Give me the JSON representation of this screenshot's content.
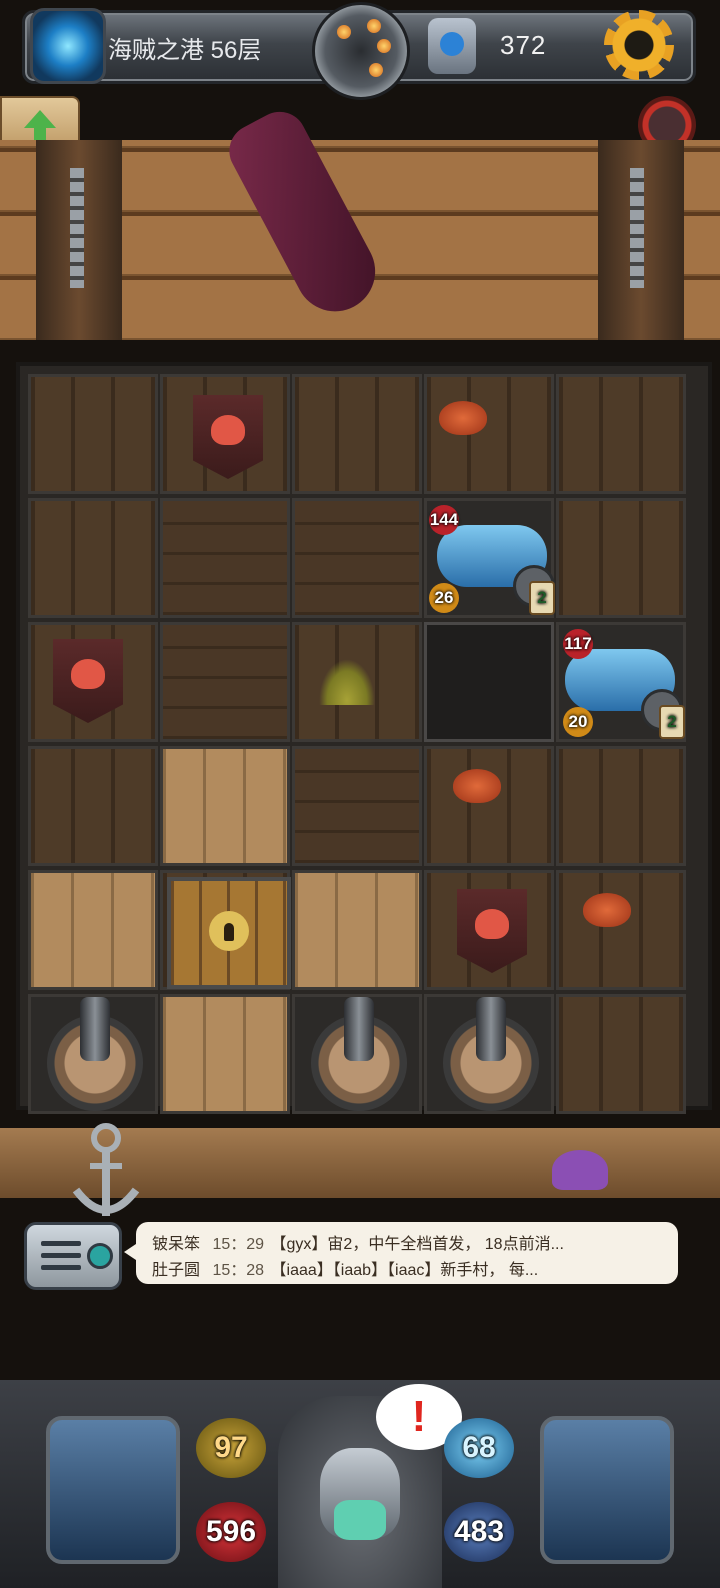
{
  "header": {
    "floor_title": "海贼之港 56层",
    "currency_value": "372",
    "settings_icon": "gear-icon",
    "portal_icon": "portal-icon",
    "bomb_medallion_icon": "bomb-medallion-icon",
    "gem_icon": "gem-icon"
  },
  "side": {
    "up_button_icon": "up-arrow-icon",
    "avatar_icon": "boss-avatar-icon"
  },
  "board": {
    "enemies": [
      {
        "name": "pirate-cannon",
        "attack": "144",
        "defense": "26",
        "level": "2"
      },
      {
        "name": "pirate-cannon",
        "attack": "117",
        "defense": "20",
        "level": "2"
      }
    ]
  },
  "chat": {
    "messages": [
      {
        "name": "铍呆笨",
        "time": "15：29",
        "text": "【gyx】宙2，中午全档首发， 18点前消..."
      },
      {
        "name": "肚子圆",
        "time": "15：28",
        "text": "【iaaa】【iaab】【iaac】新手村， 每..."
      }
    ]
  },
  "player": {
    "attack": "97",
    "defense": "68",
    "hp": "596",
    "mp": "483",
    "alert_mark": "!"
  },
  "colors": {
    "accent_gold": "#e8a123",
    "hp_red": "#d8343a",
    "def_blue": "#7ed1f5"
  }
}
